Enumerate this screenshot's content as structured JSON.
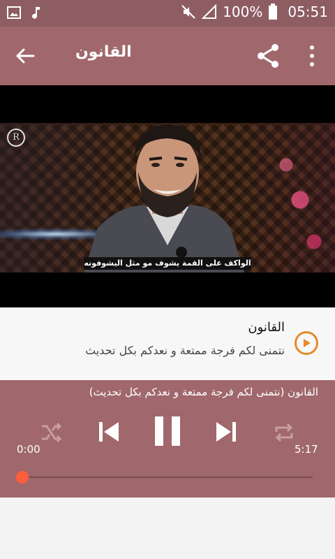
{
  "status_bar": {
    "battery": "100%",
    "time": "05:51",
    "icons": [
      "image-icon",
      "music-note-icon",
      "mute-icon",
      "signal-icon",
      "battery-icon"
    ]
  },
  "app_bar": {
    "title": "القانون",
    "icons": [
      "back-arrow-icon",
      "share-icon",
      "more-vert-icon"
    ]
  },
  "video": {
    "watermark": "R",
    "caption": "الواكف على القمة يشوف مو مثل اليشوفونه"
  },
  "track_info": {
    "title": "القانون",
    "subtitle": "نتمنى لكم فرجة ممتعة و نعدكم بكل تحديث",
    "accent_color": "#e58a2b"
  },
  "player": {
    "now_playing": "القانون (نتمنى لكم فرجة ممتعة و نعدكم بكل تحديث)",
    "elapsed": "0:00",
    "duration": "5:17",
    "progress": 0.0,
    "controls": [
      "shuffle-icon",
      "previous-icon",
      "pause-icon",
      "next-icon",
      "repeat-icon"
    ],
    "thumb_color": "#ff5e3a"
  },
  "colors": {
    "status_bar": "#8e5d62",
    "app_bar": "#a0686c",
    "player_bg": "#a0686c"
  }
}
